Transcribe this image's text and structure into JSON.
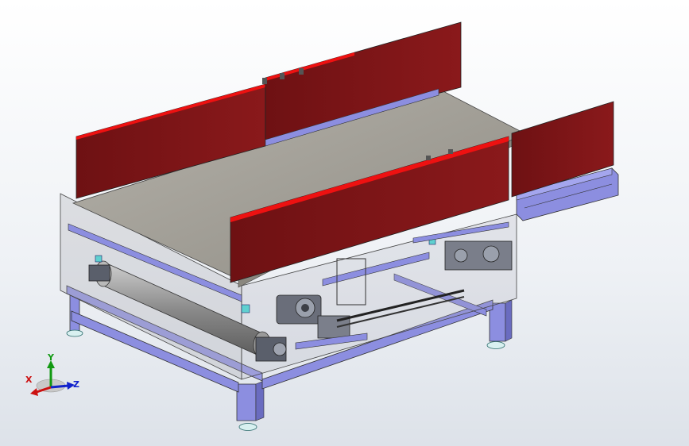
{
  "triad": {
    "x_label": "X",
    "y_label": "Y",
    "z_label": "Z",
    "x_color": "#cc1111",
    "y_color": "#119911",
    "z_color": "#1122cc"
  },
  "model": {
    "frame_color": "#8c8ee0",
    "guard_color": "#7a1416",
    "guard_edge_color": "#ee1111",
    "belt_color": "#a6a39a",
    "roller_color": "#9b9b9b",
    "bearing_color": "#5a5f6b",
    "foot_color": "#d8f0f0"
  },
  "icons": {
    "triad": "coordinate-triad-icon"
  }
}
